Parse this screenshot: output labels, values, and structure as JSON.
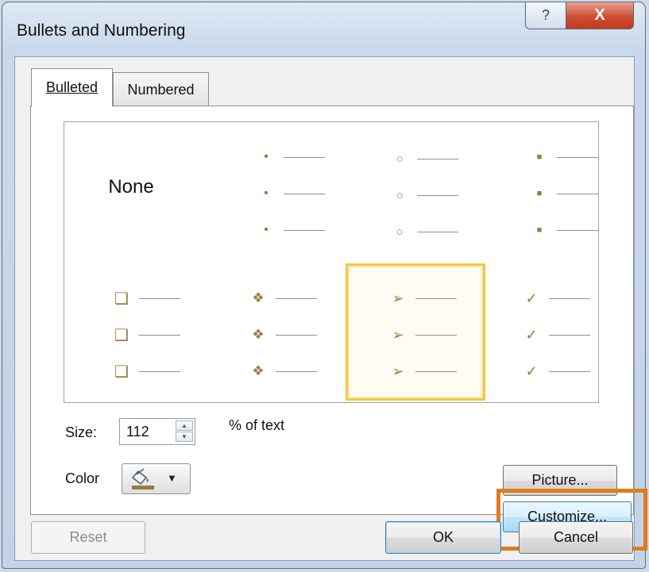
{
  "window": {
    "title": "Bullets and Numbering",
    "help_label": "?",
    "close_label": "X"
  },
  "tabs": [
    {
      "label": "Bulleted",
      "selected": true
    },
    {
      "label": "Numbered",
      "selected": false
    }
  ],
  "gallery": {
    "none_label": "None",
    "styles": [
      {
        "name": "none",
        "glyph": ""
      },
      {
        "name": "small-dot",
        "glyph": "•"
      },
      {
        "name": "hollow-circle",
        "glyph": "○"
      },
      {
        "name": "filled-square",
        "glyph": "■"
      },
      {
        "name": "hollow-square",
        "glyph": "❑"
      },
      {
        "name": "four-diamond",
        "glyph": "❖"
      },
      {
        "name": "arrowhead",
        "glyph": "➢"
      },
      {
        "name": "checkmark",
        "glyph": "✓"
      }
    ],
    "selected_style": "arrowhead",
    "bullet_color": "#9a7a3c"
  },
  "size": {
    "label": "Size:",
    "value": "112",
    "suffix": "% of text"
  },
  "color": {
    "label": "Color",
    "dropdown_arrow": "▼",
    "swatch_color": "#9a7a3c"
  },
  "buttons": {
    "picture": "Picture...",
    "customize": "Customize...",
    "reset": "Reset",
    "ok": "OK",
    "cancel": "Cancel"
  },
  "annotation": {
    "highlight_color": "#e07b1f"
  }
}
